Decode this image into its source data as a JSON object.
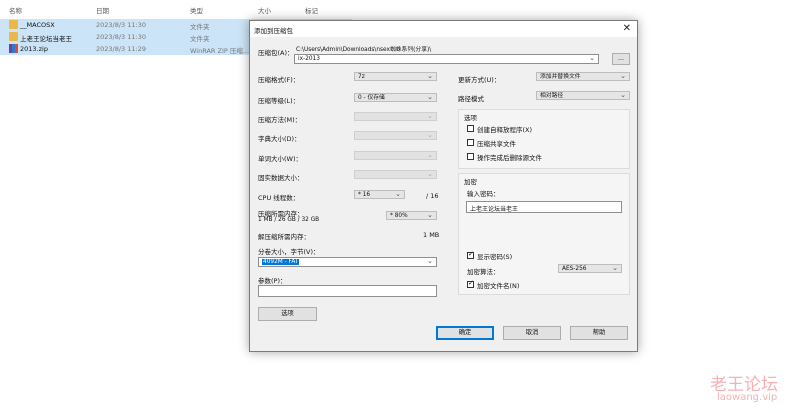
{
  "explorer": {
    "columns": [
      "名称",
      "日期",
      "类型",
      "大小",
      "标记"
    ],
    "rows": [
      {
        "name": "__MACOSX",
        "date": "2023/8/3 11:30",
        "type": "文件夹",
        "icon": "folder-icon"
      },
      {
        "name": "上老王论坛当老王",
        "date": "2023/8/3 11:30",
        "type": "文件夹",
        "icon": "folder-icon"
      },
      {
        "name": "2013.zip",
        "date": "2023/8/3 11:29",
        "type": "WinRAR ZIP 压缩...",
        "icon": "winrar-zip-icon"
      }
    ]
  },
  "dialog": {
    "title": "添加到压缩包",
    "close_glyph": "✕",
    "archive_label": "压缩包(A)：",
    "archive_path": "C:\\Users\\Admin\\Downloads\\nsex蜘蛛系列(分享)\\",
    "archive_name": "ix-2013",
    "browse_label": "...",
    "format_label": "压缩格式(F)：",
    "format_value": "7z",
    "level_label": "压缩等级(L)：",
    "level_value": "0 - 仅存储",
    "method_label": "压缩方法(M)：",
    "dict_label": "字典大小(D)：",
    "word_label": "单词大小(W)：",
    "solid_label": "固实数据大小：",
    "threads_label": "CPU 线程数：",
    "threads_value": "* 16",
    "threads_max": "/ 16",
    "memory_label": "压缩所需内存：",
    "memory_value": "1 MB / 26 GB / 32 GB",
    "memory_pct": "* 80%",
    "decomp_label": "解压缩所需内存：",
    "decomp_value": "1 MB",
    "split_label": "分卷大小，字节(V)：",
    "split_value": "4092M - FAT",
    "params_label": "参数(P)：",
    "options_button": "选项",
    "update_label": "更新方式(U)：",
    "update_value": "添加并替换文件",
    "path_label": "路径模式",
    "path_value": "相对路径",
    "options_group_title": "选项",
    "opt_sfx": "创建自释放程序(X)",
    "opt_shared": "压缩共享文件",
    "opt_delete": "操作完成后删除源文件",
    "encrypt_title": "加密",
    "password_label": "输入密码：",
    "password_value": "上老王论坛当老王",
    "show_password": "显示密码(S)",
    "enc_method_label": "加密算法：",
    "enc_method_value": "AES-256",
    "encrypt_names": "加密文件名(N)",
    "ok_button": "确定",
    "cancel_button": "取消",
    "help_button": "帮助"
  },
  "watermark": {
    "line1": "老王论坛",
    "line2": "laowang.vip"
  }
}
